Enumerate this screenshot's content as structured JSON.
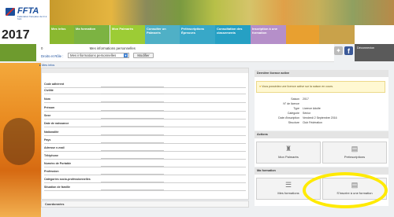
{
  "header": {
    "logo": "FFTA",
    "logo_subtitle": "Fédération française de tir à l'arc",
    "year": "2017"
  },
  "menu": [
    {
      "label": "Mes infos",
      "color": "#8ab82f"
    },
    {
      "label": "Ma formation",
      "color": "#7cb342"
    },
    {
      "label": "Mon Palmarès",
      "color": "#9ccc35"
    },
    {
      "label": "Consulter un Palmarès",
      "color": "#4fb0c6"
    },
    {
      "label": "Préinscriptions Épreuves",
      "color": "#38a8c8"
    },
    {
      "label": "Consultation des classements",
      "color": "#26a0c4"
    },
    {
      "label": "Inscription à une formation",
      "color": "#b58fc9"
    },
    {
      "label": "",
      "color": "#e8a030"
    }
  ],
  "subbar": {
    "licence_number": "0",
    "licence_text": "Mes informations personnelles",
    "droits_label": "Droits et Rôle :",
    "role_value": "Mes informations personnelles",
    "modifier_label": "Modifier",
    "logout_label": "Déconnexion"
  },
  "breadcrumb": "Mes infos",
  "form": {
    "rows": [
      "Code adhérent",
      "Civilité",
      "Nom",
      "Prénom",
      "Sexe",
      "Date de naissance",
      "Nationalité",
      "Pays",
      "Adresse e-mail",
      "Téléphone",
      "Numéro de Portable",
      "Profession",
      "Catégories socio-professionnelles",
      "Situation de famille"
    ],
    "coordonnees": "Coordonnées"
  },
  "licence": {
    "title": "Dernière licence active",
    "alert": "Vous possédez une licence active sur la saison en cours.",
    "fields": [
      {
        "key": "Saison",
        "value": "2017"
      },
      {
        "key": "N° de licence",
        "value": ""
      },
      {
        "key": "Type",
        "value": "Licence Adulte"
      },
      {
        "key": "Catégorie",
        "value": "Sénior"
      },
      {
        "key": "Date d'inscription",
        "value": "Vendredi 2 Septembre 2016"
      },
      {
        "key": "Structure",
        "value": "Club Fédération"
      }
    ]
  },
  "actions": {
    "title": "Actions",
    "palmares": "Mon Palmarès",
    "preinscriptions": "Préinscriptions"
  },
  "formation": {
    "title": "Ma formation",
    "mes_formations": "Mes formations",
    "inscrire": "S'inscrire à une formation"
  }
}
